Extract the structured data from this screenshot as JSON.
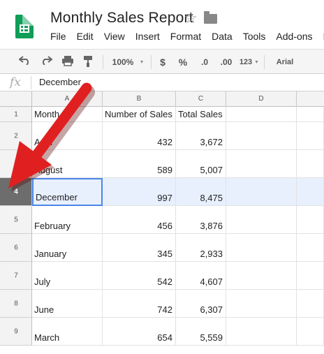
{
  "document": {
    "title": "Monthly Sales Report",
    "star_icon": "star-outline-icon",
    "folder_icon": "folder-icon"
  },
  "menu": [
    "File",
    "Edit",
    "View",
    "Insert",
    "Format",
    "Data",
    "Tools",
    "Add-ons",
    "He"
  ],
  "toolbar": {
    "undo_icon": "undo-icon",
    "redo_icon": "redo-icon",
    "print_icon": "print-icon",
    "paint_format_icon": "paint-format-icon",
    "zoom": "100%",
    "currency": "$",
    "percent": "%",
    "decrease_decimal": ".0",
    "increase_decimal": ".00",
    "more_formats": "123",
    "font": "Arial"
  },
  "formula_bar": {
    "fx_label": "fx",
    "value": "December"
  },
  "columns": [
    "A",
    "B",
    "C",
    "D"
  ],
  "rows": [
    {
      "num": "1",
      "a": "Month",
      "b": "Number of Sales",
      "c": "Total Sales"
    },
    {
      "num": "2",
      "a": "April",
      "b": "432",
      "c": "3,672"
    },
    {
      "num": "3",
      "a": "August",
      "b": "589",
      "c": "5,007"
    },
    {
      "num": "4",
      "a": "December",
      "b": "997",
      "c": "8,475"
    },
    {
      "num": "5",
      "a": "February",
      "b": "456",
      "c": "3,876"
    },
    {
      "num": "6",
      "a": "January",
      "b": "345",
      "c": "2,933"
    },
    {
      "num": "7",
      "a": "July",
      "b": "542",
      "c": "4,607"
    },
    {
      "num": "8",
      "a": "June",
      "b": "742",
      "c": "6,307"
    },
    {
      "num": "9",
      "a": "March",
      "b": "654",
      "c": "5,559"
    }
  ],
  "annotation": {
    "arrow_color": "#e02020",
    "arrow_icon": "red-arrow-annotation"
  },
  "colors": {
    "sheets_green": "#0f9d58",
    "selected_row_header": "#6d6d6d",
    "selected_row_fill": "#e8f0fe",
    "active_cell_border": "#4a86e8"
  }
}
